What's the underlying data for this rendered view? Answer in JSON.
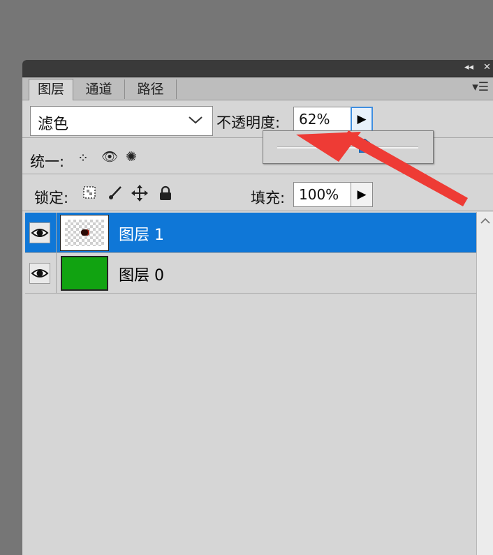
{
  "titlebar": {
    "collapse_icon": "double-chevron-left-icon",
    "close_icon": "close-icon"
  },
  "tabs": [
    {
      "label": "图层",
      "active": true
    },
    {
      "label": "通道",
      "active": false
    },
    {
      "label": "路径",
      "active": false
    }
  ],
  "panel_menu_icon": "panel-menu-icon",
  "blend_mode": {
    "value": "滤色",
    "icon": "chevron-down-icon"
  },
  "opacity": {
    "label": "不透明度:",
    "value": "62%",
    "slider_level": 0.62,
    "button_icon": "triangle-right-icon"
  },
  "unify": {
    "label": "统一:",
    "icons": [
      "unify-position-icon",
      "unify-visibility-icon",
      "unify-style-icon"
    ]
  },
  "lock": {
    "label": "锁定:",
    "icons": [
      "lock-transparent-pixels-icon",
      "lock-image-pixels-icon",
      "lock-position-icon",
      "lock-all-icon"
    ]
  },
  "fill": {
    "label": "填充:",
    "value": "100%",
    "button_icon": "triangle-right-icon"
  },
  "layers": [
    {
      "name": "图层 1",
      "selected": true,
      "visible": true,
      "thumbnail": "transparent-checker"
    },
    {
      "name": "图层 0",
      "selected": false,
      "visible": true,
      "thumbnail": "solid",
      "color": "#11a311"
    }
  ],
  "colors": {
    "selection": "#0f77d7",
    "annotation_arrow": "#ee3b35",
    "panel_bg": "#d6d6d6"
  }
}
